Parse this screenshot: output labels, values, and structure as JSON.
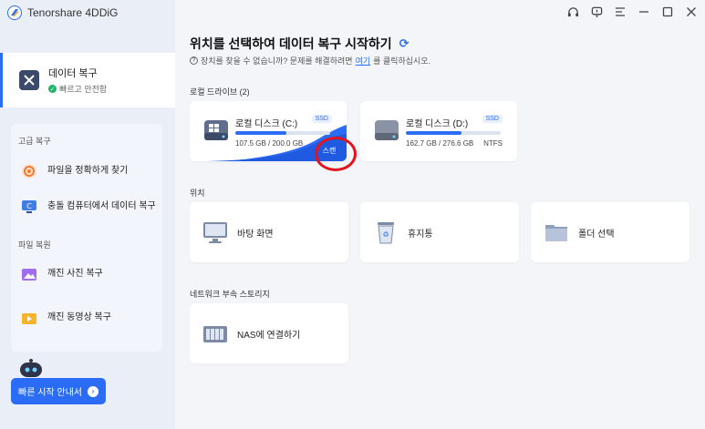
{
  "app": {
    "name": "Tenorshare 4DDiG"
  },
  "sidebar": {
    "primary": {
      "title": "데이터 복구",
      "subtitle": "빠르고 안전함"
    },
    "advanced_label": "고급 복구",
    "advanced_items": [
      {
        "label": "파일을 정확하게 찾기"
      },
      {
        "label": "충돌 컴퓨터에서 데이터 복구"
      }
    ],
    "file_label": "파일 복원",
    "file_items": [
      {
        "label": "깨진 사진 복구"
      },
      {
        "label": "깨진 동영상 복구"
      }
    ],
    "quick_start": "빠른 시작 안내서"
  },
  "main": {
    "title": "위치를 선택하여 데이터 복구 시작하기",
    "help_prefix": "장치를 찾을 수 없습니까? 문제를 해결하려면 ",
    "help_link": "여기",
    "help_suffix": "를 클릭하십시오.",
    "local_section": "로컬 드라이브 (2)",
    "drives": [
      {
        "name": "로컬 디스크 (C:)",
        "badge": "SSD",
        "size": "107.5 GB / 200.0 GB",
        "fs": "",
        "used_fraction": 0.54,
        "scan_label": "스캔"
      },
      {
        "name": "로컬 디스크 (D:)",
        "badge": "SSD",
        "size": "162.7 GB / 276.6 GB",
        "fs": "NTFS",
        "used_fraction": 0.59
      }
    ],
    "location_section": "위치",
    "locations": [
      {
        "label": "바탕 화면"
      },
      {
        "label": "휴지통"
      },
      {
        "label": "폴더 선택"
      }
    ],
    "network_section": "네트워크 부속 스토리지",
    "nas_label": "NAS에 연결하기"
  },
  "colors": {
    "accent": "#2b6cf6",
    "highlight": "#e3141b"
  }
}
